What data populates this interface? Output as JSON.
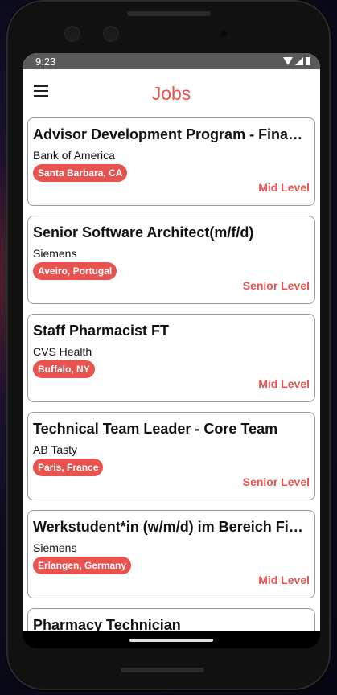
{
  "status_bar": {
    "time": "9:23"
  },
  "app_bar": {
    "title": "Jobs"
  },
  "jobs": [
    {
      "title": "Advisor Development Program - Financi…",
      "company": "Bank of America",
      "location": "Santa Barbara, CA",
      "level": "Mid Level"
    },
    {
      "title": "Senior Software Architect(m/f/d)",
      "company": "Siemens",
      "location": "Aveiro, Portugal",
      "level": "Senior Level"
    },
    {
      "title": "Staff Pharmacist FT",
      "company": "CVS Health",
      "location": "Buffalo, NY",
      "level": "Mid Level"
    },
    {
      "title": "Technical Team Leader - Core Team",
      "company": "AB Tasty",
      "location": "Paris, France",
      "level": "Senior Level"
    },
    {
      "title": "Werkstudent*in (w/m/d) im Bereich Fina…",
      "company": "Siemens",
      "location": "Erlangen, Germany",
      "level": "Mid Level"
    },
    {
      "title": "Pharmacy Technician"
    }
  ],
  "colors": {
    "accent": "#e8524f",
    "status_bar": "#5a5a5a"
  }
}
